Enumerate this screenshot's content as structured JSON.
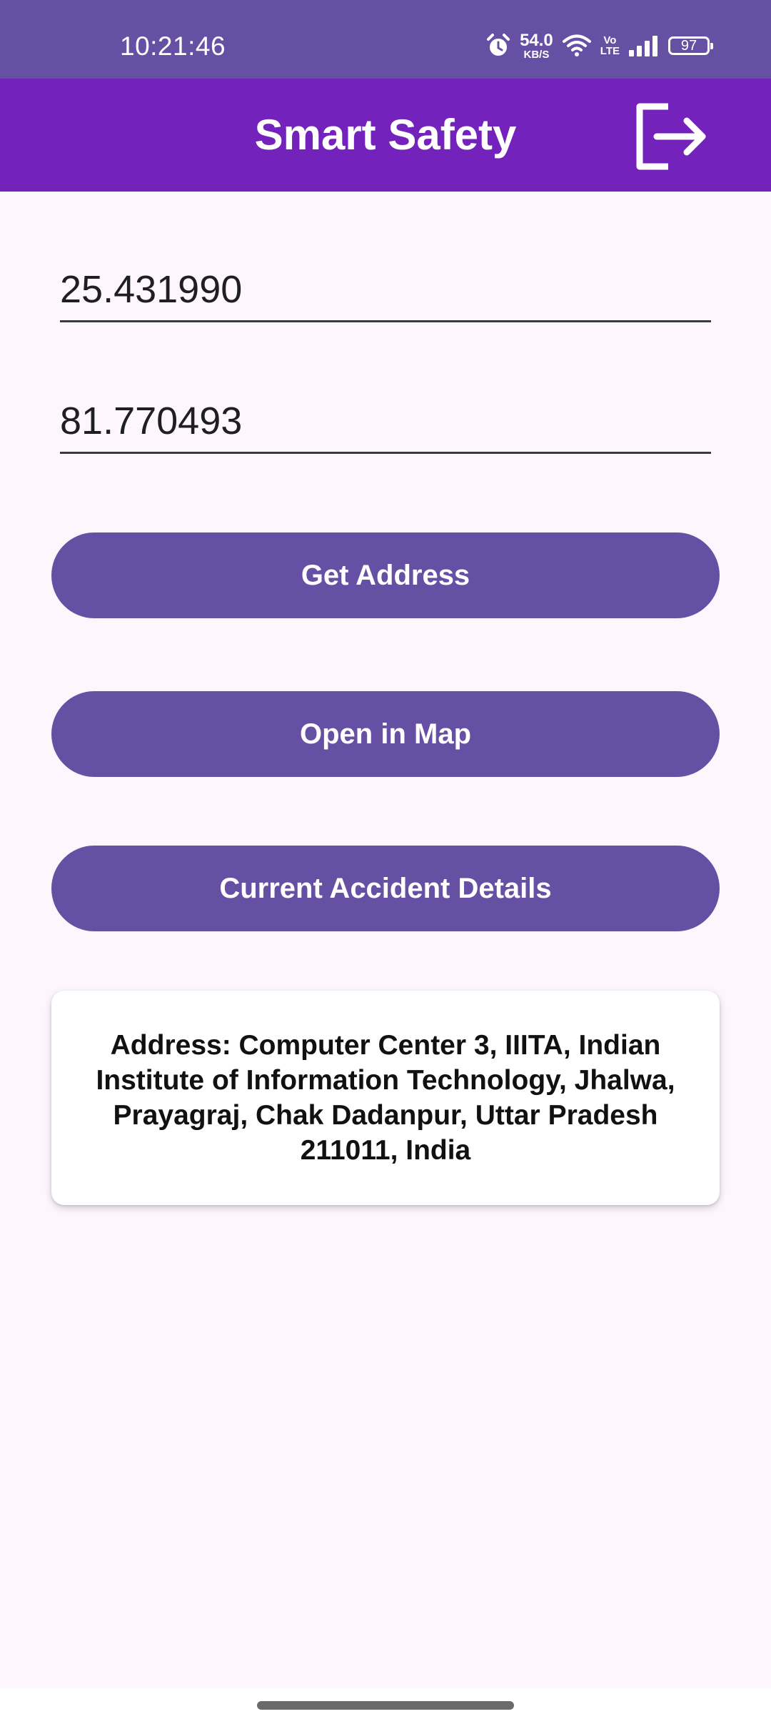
{
  "status_bar": {
    "time": "10:21:46",
    "net_speed_value": "54.0",
    "net_speed_unit": "KB/S",
    "volte_top": "Vo",
    "volte_bottom": "LTE",
    "battery": "97",
    "icons": [
      "alarm-icon",
      "wifi-icon",
      "signal-icon",
      "battery-icon"
    ]
  },
  "app_bar": {
    "title": "Smart Safety",
    "action_icon": "logout-icon",
    "background": "#7322bb"
  },
  "form": {
    "latitude": "25.431990",
    "longitude": "81.770493"
  },
  "buttons": {
    "get_address": "Get Address",
    "open_in_map": "Open in Map",
    "current_accident_details": "Current Accident Details",
    "color": "#6650a4"
  },
  "address_card": {
    "text": "Address: Computer Center 3, IIITA, Indian Institute of Information Technology, Jhalwa, Prayagraj, Chak Dadanpur, Uttar Pradesh 211011, India"
  }
}
